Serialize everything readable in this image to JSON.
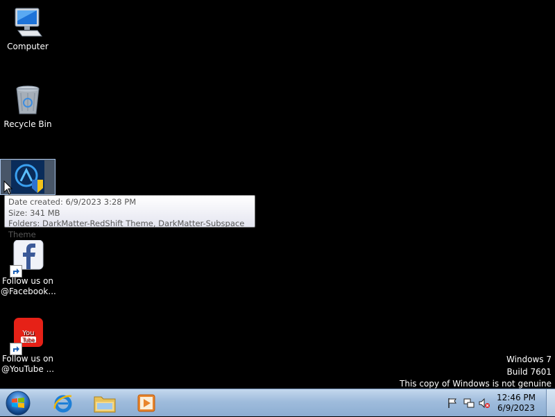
{
  "desktop_icons": [
    {
      "id": "computer",
      "label": "Computer"
    },
    {
      "id": "recycle-bin",
      "label": "Recycle Bin"
    },
    {
      "id": "themes-folder",
      "label": ""
    },
    {
      "id": "facebook",
      "label_line1": "Follow us on",
      "label_line2": "@Facebook..."
    },
    {
      "id": "youtube",
      "label_line1": "Follow us on",
      "label_line2": "@YouTube ..."
    }
  ],
  "tooltip": {
    "date_created": "Date created: 6/9/2023 3:28 PM",
    "size": "Size: 341 MB",
    "folders": "Folders: DarkMatter-RedShift Theme, DarkMatter-Subspace Theme"
  },
  "watermark": {
    "line1": "Windows 7",
    "line2": "Build 7601",
    "line3": "This copy of Windows is not genuine"
  },
  "taskbar": {
    "pinned": [
      "start-button",
      "internet-explorer",
      "windows-explorer",
      "media-player"
    ],
    "tray_icons": [
      "action-center-flag-icon",
      "network-icon",
      "volume-muted-icon"
    ]
  },
  "clock": {
    "time": "12:46 PM",
    "date": "6/9/2023"
  },
  "colors": {
    "desktop_bg": "#000000",
    "taskbar": "#9fbcdc",
    "selection": "#a8c4e8"
  }
}
